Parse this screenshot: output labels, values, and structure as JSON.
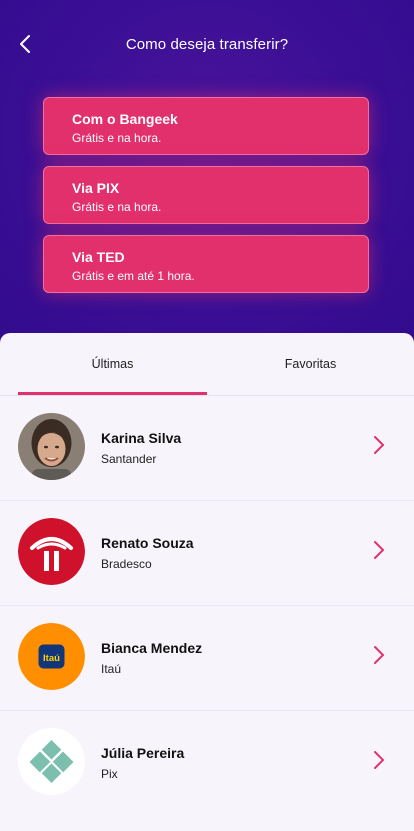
{
  "header": {
    "title": "Como deseja transferir?"
  },
  "options": [
    {
      "title": "Com o Bangeek",
      "subtitle": "Grátis e na hora."
    },
    {
      "title": "Via PIX",
      "subtitle": "Grátis e na hora."
    },
    {
      "title": "Via TED",
      "subtitle": "Grátis e em até 1 hora."
    }
  ],
  "tabs": {
    "latest": "Últimas",
    "favorites": "Favoritas",
    "active": "latest"
  },
  "contacts": [
    {
      "name": "Karina Silva",
      "bank": "Santander",
      "avatar": "person-photo"
    },
    {
      "name": "Renato Souza",
      "bank": "Bradesco",
      "avatar": "bradesco-logo"
    },
    {
      "name": "Bianca Mendez",
      "bank": "Itaú",
      "avatar": "itau-logo",
      "logo_text": "Itaú"
    },
    {
      "name": "Júlia Pereira",
      "bank": "Pix",
      "avatar": "pix-logo"
    }
  ],
  "colors": {
    "primary": "#3a0f95",
    "accent": "#e2306c",
    "sheet": "#f7f5fb"
  }
}
